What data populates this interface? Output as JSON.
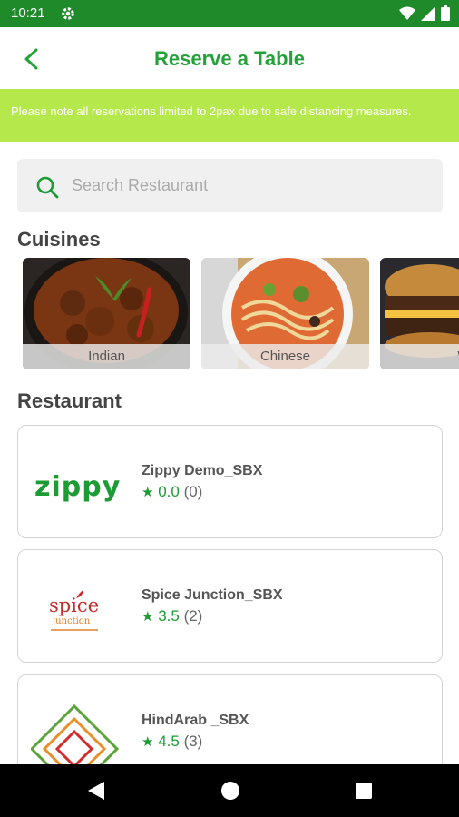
{
  "status_bar": {
    "time": "10:21"
  },
  "app_bar": {
    "title": "Reserve a Table"
  },
  "notice": {
    "text": "Please note all reservations limited to 2pax due to safe distancing measures."
  },
  "search": {
    "placeholder": "Search Restaurant"
  },
  "sections": {
    "cuisines_title": "Cuisines",
    "restaurant_title": "Restaurant"
  },
  "cuisines": [
    {
      "label": "Indian"
    },
    {
      "label": "Chinese"
    },
    {
      "label": "W"
    }
  ],
  "restaurants": [
    {
      "name": "Zippy Demo_SBX",
      "rating": "0.0",
      "count": "(0)",
      "logo_text": "zippy"
    },
    {
      "name": "Spice Junction_SBX",
      "rating": "3.5",
      "count": "(2)",
      "logo_text": "spice",
      "logo_subtext": "junction"
    },
    {
      "name": "HindArab _SBX",
      "rating": "4.5",
      "count": "(3)"
    }
  ],
  "colors": {
    "status_bar": "#1f8a2a",
    "accent": "#24a23a",
    "notice_bg": "#b5e84a",
    "star": "#1d9b34"
  }
}
